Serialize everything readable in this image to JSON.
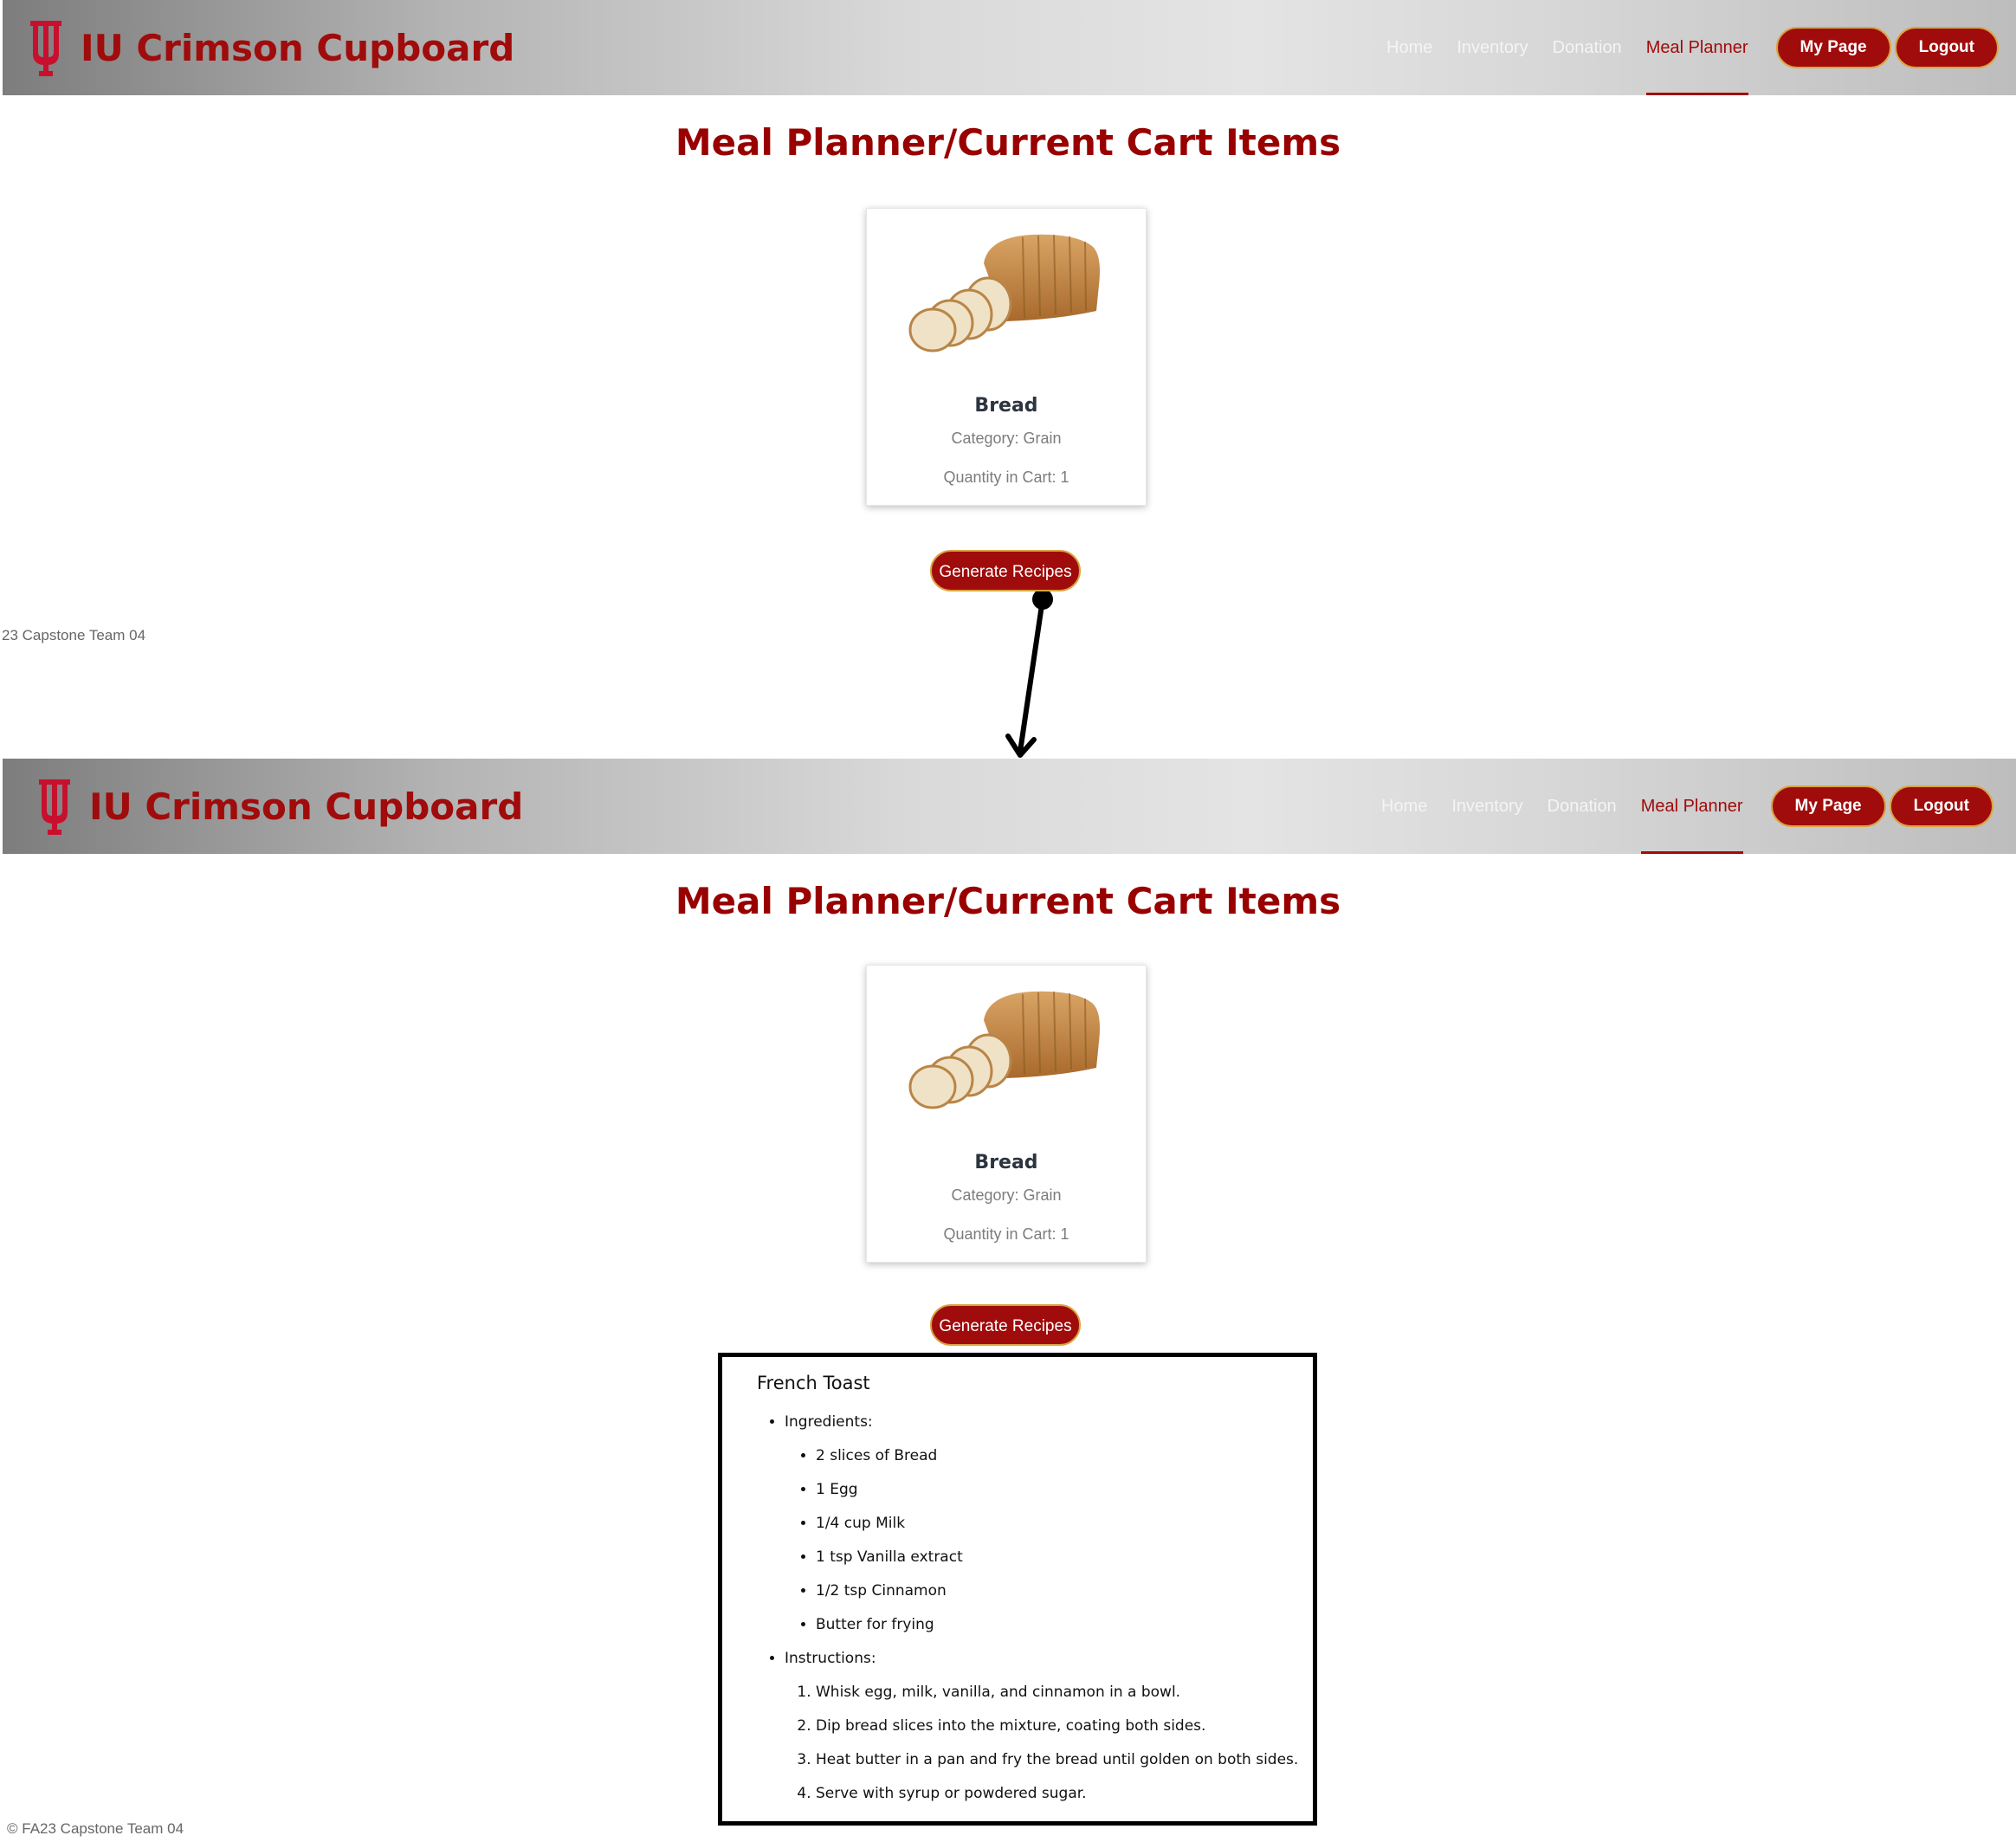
{
  "brand": {
    "name": "IU Crimson Cupboard"
  },
  "nav": {
    "links": [
      "Home",
      "Inventory",
      "Donation",
      "Meal Planner"
    ],
    "active": "Meal Planner",
    "my_page": "My Page",
    "logout": "Logout"
  },
  "page": {
    "title": "Meal Planner/Current Cart Items"
  },
  "cart_item": {
    "name": "Bread",
    "category": "Category: Grain",
    "quantity": "Quantity in Cart: 1",
    "image_icon": "bread-loaf-image"
  },
  "actions": {
    "generate_recipes": "Generate Recipes"
  },
  "footer": {
    "top_text": "23 Capstone Team 04",
    "bottom_text": "© FA23 Capstone Team 04"
  },
  "recipe": {
    "title": "French Toast",
    "ingredients_label": "Ingredients:",
    "ingredients": [
      "2 slices of Bread",
      "1 Egg",
      "1/4 cup Milk",
      "1 tsp Vanilla extract",
      "1/2 tsp Cinnamon",
      "Butter for frying"
    ],
    "instructions_label": "Instructions:",
    "instructions": [
      "Whisk egg, milk, vanilla, and cinnamon in a bowl.",
      "Dip bread slices into the mixture, coating both sides.",
      "Heat butter in a pan and fry the bread until golden on both sides.",
      "Serve with syrup or powdered sugar."
    ]
  },
  "colors": {
    "crimson": "#990000",
    "button_border": "#d9a441",
    "nav_text": "#f4f4f4"
  }
}
